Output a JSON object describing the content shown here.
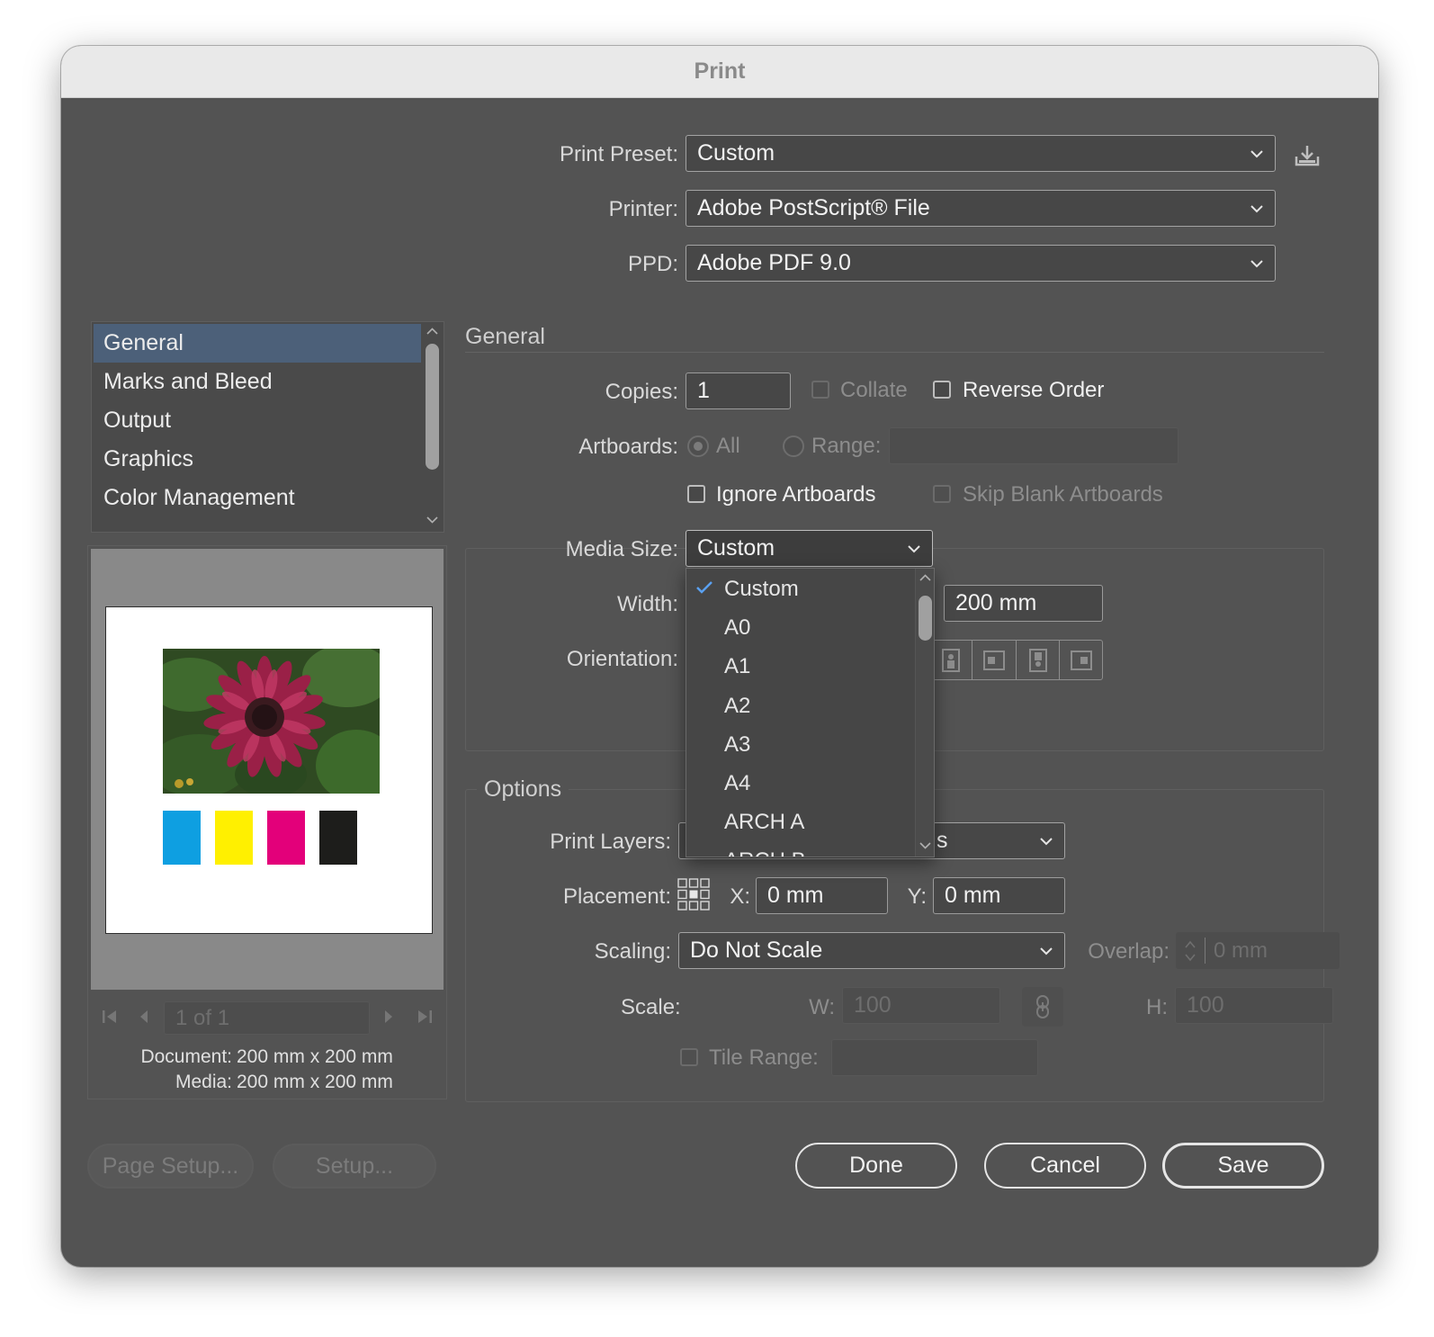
{
  "window": {
    "title": "Print"
  },
  "top": {
    "print_preset_label": "Print Preset:",
    "print_preset_value": "Custom",
    "printer_label": "Printer:",
    "printer_value": "Adobe PostScript® File",
    "ppd_label": "PPD:",
    "ppd_value": "Adobe PDF 9.0"
  },
  "sidebar": {
    "items": [
      {
        "label": "General",
        "selected": true
      },
      {
        "label": "Marks and Bleed"
      },
      {
        "label": "Output"
      },
      {
        "label": "Graphics"
      },
      {
        "label": "Color Management"
      }
    ]
  },
  "preview": {
    "swatch_colors": [
      "#0e9fe1",
      "#fff000",
      "#e3007a",
      "#1d1d1b"
    ],
    "page_indicator": "1 of 1",
    "document_label": "Document:",
    "document_value": "200 mm x 200 mm",
    "media_label": "Media:",
    "media_value": "200 mm x 200 mm"
  },
  "general": {
    "title": "General",
    "copies_label": "Copies:",
    "copies_value": "1",
    "collate_label": "Collate",
    "reverse_order_label": "Reverse Order",
    "artboards_label": "Artboards:",
    "all_label": "All",
    "range_label": "Range:",
    "ignore_artboards_label": "Ignore Artboards",
    "skip_blank_label": "Skip Blank Artboards"
  },
  "media": {
    "media_size_label": "Media Size:",
    "media_size_value": "Custom",
    "width_label": "Width:",
    "height_value": "200 mm",
    "orientation_label": "Orientation:",
    "dropdown_items": [
      "Custom",
      "A0",
      "A1",
      "A2",
      "A3",
      "A4",
      "ARCH A",
      "ARCH B"
    ],
    "dropdown_selected": "Custom"
  },
  "options": {
    "title": "Options",
    "print_layers_label": "Print Layers:",
    "print_layers_value_fragment": "s",
    "placement_label": "Placement:",
    "x_label": "X:",
    "x_value": "0 mm",
    "y_label": "Y:",
    "y_value": "0 mm",
    "scaling_label": "Scaling:",
    "scaling_value": "Do Not Scale",
    "overlap_label": "Overlap:",
    "overlap_value": "0 mm",
    "scale_label": "Scale:",
    "w_label": "W:",
    "w_value": "100",
    "h_label": "H:",
    "h_value": "100",
    "tile_range_label": "Tile Range:"
  },
  "buttons": {
    "page_setup": "Page Setup...",
    "setup": "Setup...",
    "done": "Done",
    "cancel": "Cancel",
    "save": "Save"
  }
}
